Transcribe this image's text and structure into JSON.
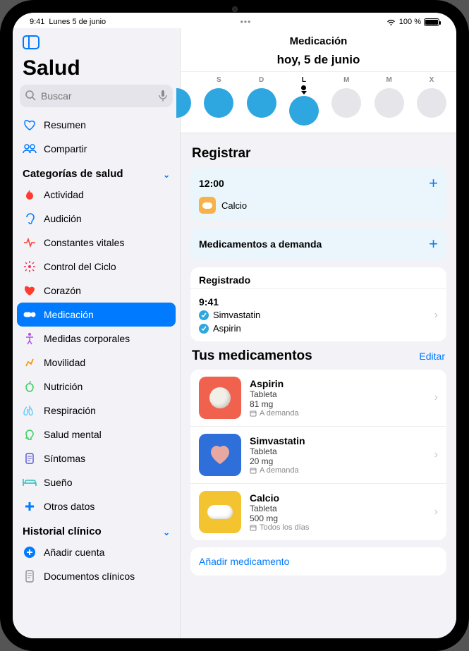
{
  "status": {
    "time": "9:41",
    "date": "Lunes 5 de junio",
    "battery": "100 %"
  },
  "sidebar": {
    "title": "Salud",
    "search_placeholder": "Buscar",
    "top": [
      {
        "label": "Resumen"
      },
      {
        "label": "Compartir"
      }
    ],
    "section_categories": "Categorías de salud",
    "categories": [
      {
        "label": "Actividad"
      },
      {
        "label": "Audición"
      },
      {
        "label": "Constantes vitales"
      },
      {
        "label": "Control del Ciclo"
      },
      {
        "label": "Corazón"
      },
      {
        "label": "Medicación"
      },
      {
        "label": "Medidas corporales"
      },
      {
        "label": "Movilidad"
      },
      {
        "label": "Nutrición"
      },
      {
        "label": "Respiración"
      },
      {
        "label": "Salud mental"
      },
      {
        "label": "Síntomas"
      },
      {
        "label": "Sueño"
      },
      {
        "label": "Otros datos"
      }
    ],
    "section_records": "Historial clínico",
    "records": [
      {
        "label": "Añadir cuenta"
      },
      {
        "label": "Documentos clínicos"
      }
    ]
  },
  "main": {
    "title": "Medicación",
    "subtitle": "hoy, 5 de junio",
    "days": [
      "S",
      "D",
      "L",
      "M",
      "M",
      "X"
    ],
    "active_day_index": 2,
    "registrar": {
      "heading": "Registrar",
      "time": "12:00",
      "med": "Calcio",
      "on_demand": "Medicamentos a demanda",
      "registered_header": "Registrado",
      "registered_time": "9:41",
      "registered_meds": [
        "Simvastatin",
        "Aspirin"
      ]
    },
    "your_meds": {
      "heading": "Tus medicamentos",
      "edit": "Editar",
      "items": [
        {
          "name": "Aspirin",
          "form": "Tableta",
          "dose": "81 mg",
          "schedule": "A demanda",
          "tile_color": "#f0624d",
          "pill_shape": "round",
          "pill_color": "#f2efe9"
        },
        {
          "name": "Simvastatin",
          "form": "Tableta",
          "dose": "20 mg",
          "schedule": "A demanda",
          "tile_color": "#2e6fd9",
          "pill_shape": "heart",
          "pill_color": "#e6a8a0"
        },
        {
          "name": "Calcio",
          "form": "Tableta",
          "dose": "500 mg",
          "schedule": "Todos los días",
          "tile_color": "#f4c430",
          "pill_shape": "capsule",
          "pill_color": "#ffffff"
        }
      ],
      "add": "Añadir medicamento"
    }
  }
}
